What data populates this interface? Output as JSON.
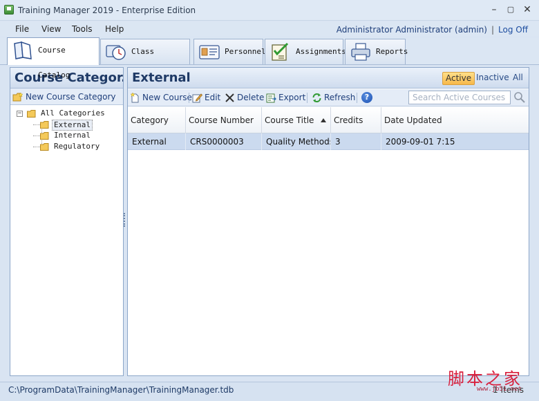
{
  "window": {
    "title": "Training Manager 2019 - Enterprise Edition"
  },
  "menu": {
    "items": [
      "File",
      "View",
      "Tools",
      "Help"
    ],
    "user": "Administrator Administrator (admin)",
    "separator": "|",
    "logoff": "Log Off"
  },
  "tabs": [
    {
      "label": "Course Catalog",
      "icon": "book-icon",
      "active": true
    },
    {
      "label": "Class Sessions",
      "icon": "clock-icon",
      "active": false
    },
    {
      "label": "Personnel",
      "icon": "id-card-icon",
      "active": false
    },
    {
      "label": "Assignments",
      "icon": "checklist-icon",
      "active": false
    },
    {
      "label": "Reports",
      "icon": "printer-icon",
      "active": false
    }
  ],
  "left_panel": {
    "title": "Course Categor...",
    "new_button": "New Course Category",
    "tree": {
      "root": "All Categories",
      "expander": "−",
      "children": [
        "External",
        "Internal",
        "Regulatory"
      ],
      "selected": "External"
    }
  },
  "main_panel": {
    "title": "External",
    "filters": {
      "active": "Active",
      "inactive": "Inactive",
      "all": "All",
      "selected": "Active"
    },
    "toolbar": {
      "new_course": "New Course",
      "edit": "Edit",
      "delete": "Delete",
      "export": "Export",
      "refresh": "Refresh",
      "help": "?"
    },
    "search": {
      "placeholder": "Search Active Courses",
      "value": ""
    },
    "grid": {
      "columns": [
        "Category",
        "Course Number",
        "Course Title",
        "Credits",
        "Date Updated"
      ],
      "sort_column": "Course Title",
      "sort_direction": "ascending",
      "rows": [
        [
          "External",
          "CRS0000003",
          "Quality Methods",
          "3",
          "2009-09-01 7:15"
        ]
      ]
    }
  },
  "status": {
    "path": "C:\\ProgramData\\TrainingManager\\TrainingManager.tdb",
    "count": "1 Items"
  },
  "watermark": {
    "text": "脚本之家",
    "url": "www.jb51.net"
  },
  "colors": {
    "accent": "#1f3a66",
    "selection": "#cbdaef",
    "active_filter": "#f7b84a",
    "watermark": "#d81e3c"
  }
}
